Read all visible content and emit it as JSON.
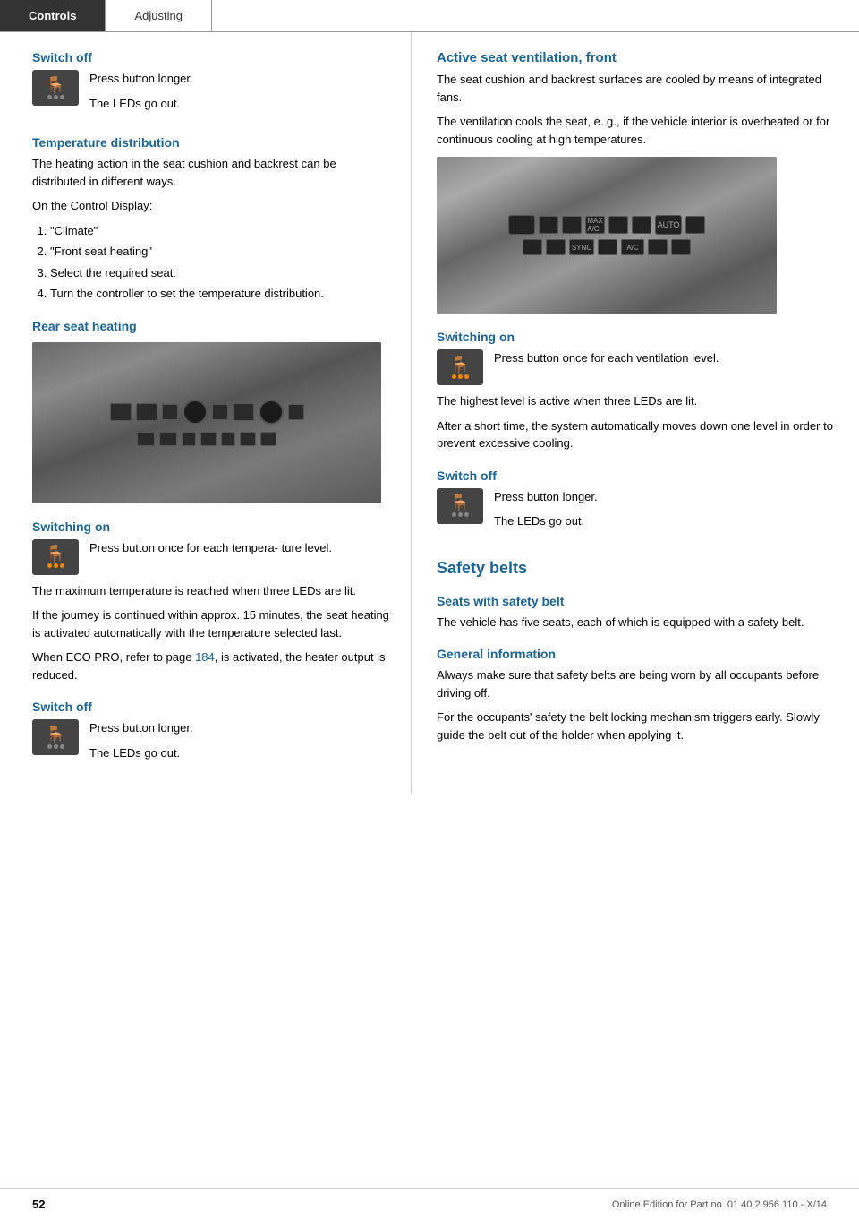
{
  "tabs": [
    {
      "id": "controls",
      "label": "Controls",
      "active": true
    },
    {
      "id": "adjusting",
      "label": "Adjusting",
      "active": false
    }
  ],
  "left_column": {
    "switch_off_heading": "Switch off",
    "switch_off_text1": "Press button longer.",
    "switch_off_text2": "The LEDs go out.",
    "temp_dist_heading": "Temperature distribution",
    "temp_dist_p1": "The heating action in the seat cushion and backrest can be distributed in different ways.",
    "temp_dist_p2": "On the Control Display:",
    "temp_dist_list": [
      {
        "num": "1.",
        "text": "\"Climate\""
      },
      {
        "num": "2.",
        "text": "\"Front seat heating\""
      },
      {
        "num": "3.",
        "text": "Select the required seat."
      },
      {
        "num": "4.",
        "text": "Turn the controller to set the temperature distribution."
      }
    ],
    "rear_seat_heading": "Rear seat heating",
    "switching_on_heading": "Switching on",
    "switching_on_text1": "Press button once for each tempera- ture level.",
    "switching_on_p2": "The maximum temperature is reached when three LEDs are lit.",
    "switching_on_p3": "If the journey is continued within approx. 15 minutes, the seat heating is activated automatically with the temperature selected last.",
    "switching_on_p4_prefix": "When ECO PRO, refer to page ",
    "switching_on_p4_link": "184",
    "switching_on_p4_suffix": ", is activated, the heater output is reduced.",
    "switch_off2_heading": "Switch off",
    "switch_off2_text1": "Press button longer.",
    "switch_off2_text2": "The LEDs go out."
  },
  "right_column": {
    "active_vent_heading": "Active seat ventilation, front",
    "active_vent_p1": "The seat cushion and backrest surfaces are cooled by means of integrated fans.",
    "active_vent_p2": "The ventilation cools the seat, e. g., if the vehicle interior is overheated or for continuous cooling at high temperatures.",
    "switching_on_heading": "Switching on",
    "switching_on_text1": "Press button once for each ventilation level.",
    "switching_on_p2": "The highest level is active when three LEDs are lit.",
    "switching_on_p3": "After a short time, the system automatically moves down one level in order to prevent excessive cooling.",
    "switch_off_heading": "Switch off",
    "switch_off_text1": "Press button longer.",
    "switch_off_text2": "The LEDs go out.",
    "safety_belts_heading": "Safety belts",
    "seats_with_belt_heading": "Seats with safety belt",
    "seats_with_belt_p": "The vehicle has five seats, each of which is equipped with a safety belt.",
    "general_info_heading": "General information",
    "general_info_p1": "Always make sure that safety belts are being worn by all occupants before driving off.",
    "general_info_p2": "For the occupants' safety the belt locking mechanism triggers early. Slowly guide the belt out of the holder when applying it."
  },
  "footer": {
    "page_number": "52",
    "edition_text": "Online Edition for Part no. 01 40 2 956 110 - X/14"
  }
}
